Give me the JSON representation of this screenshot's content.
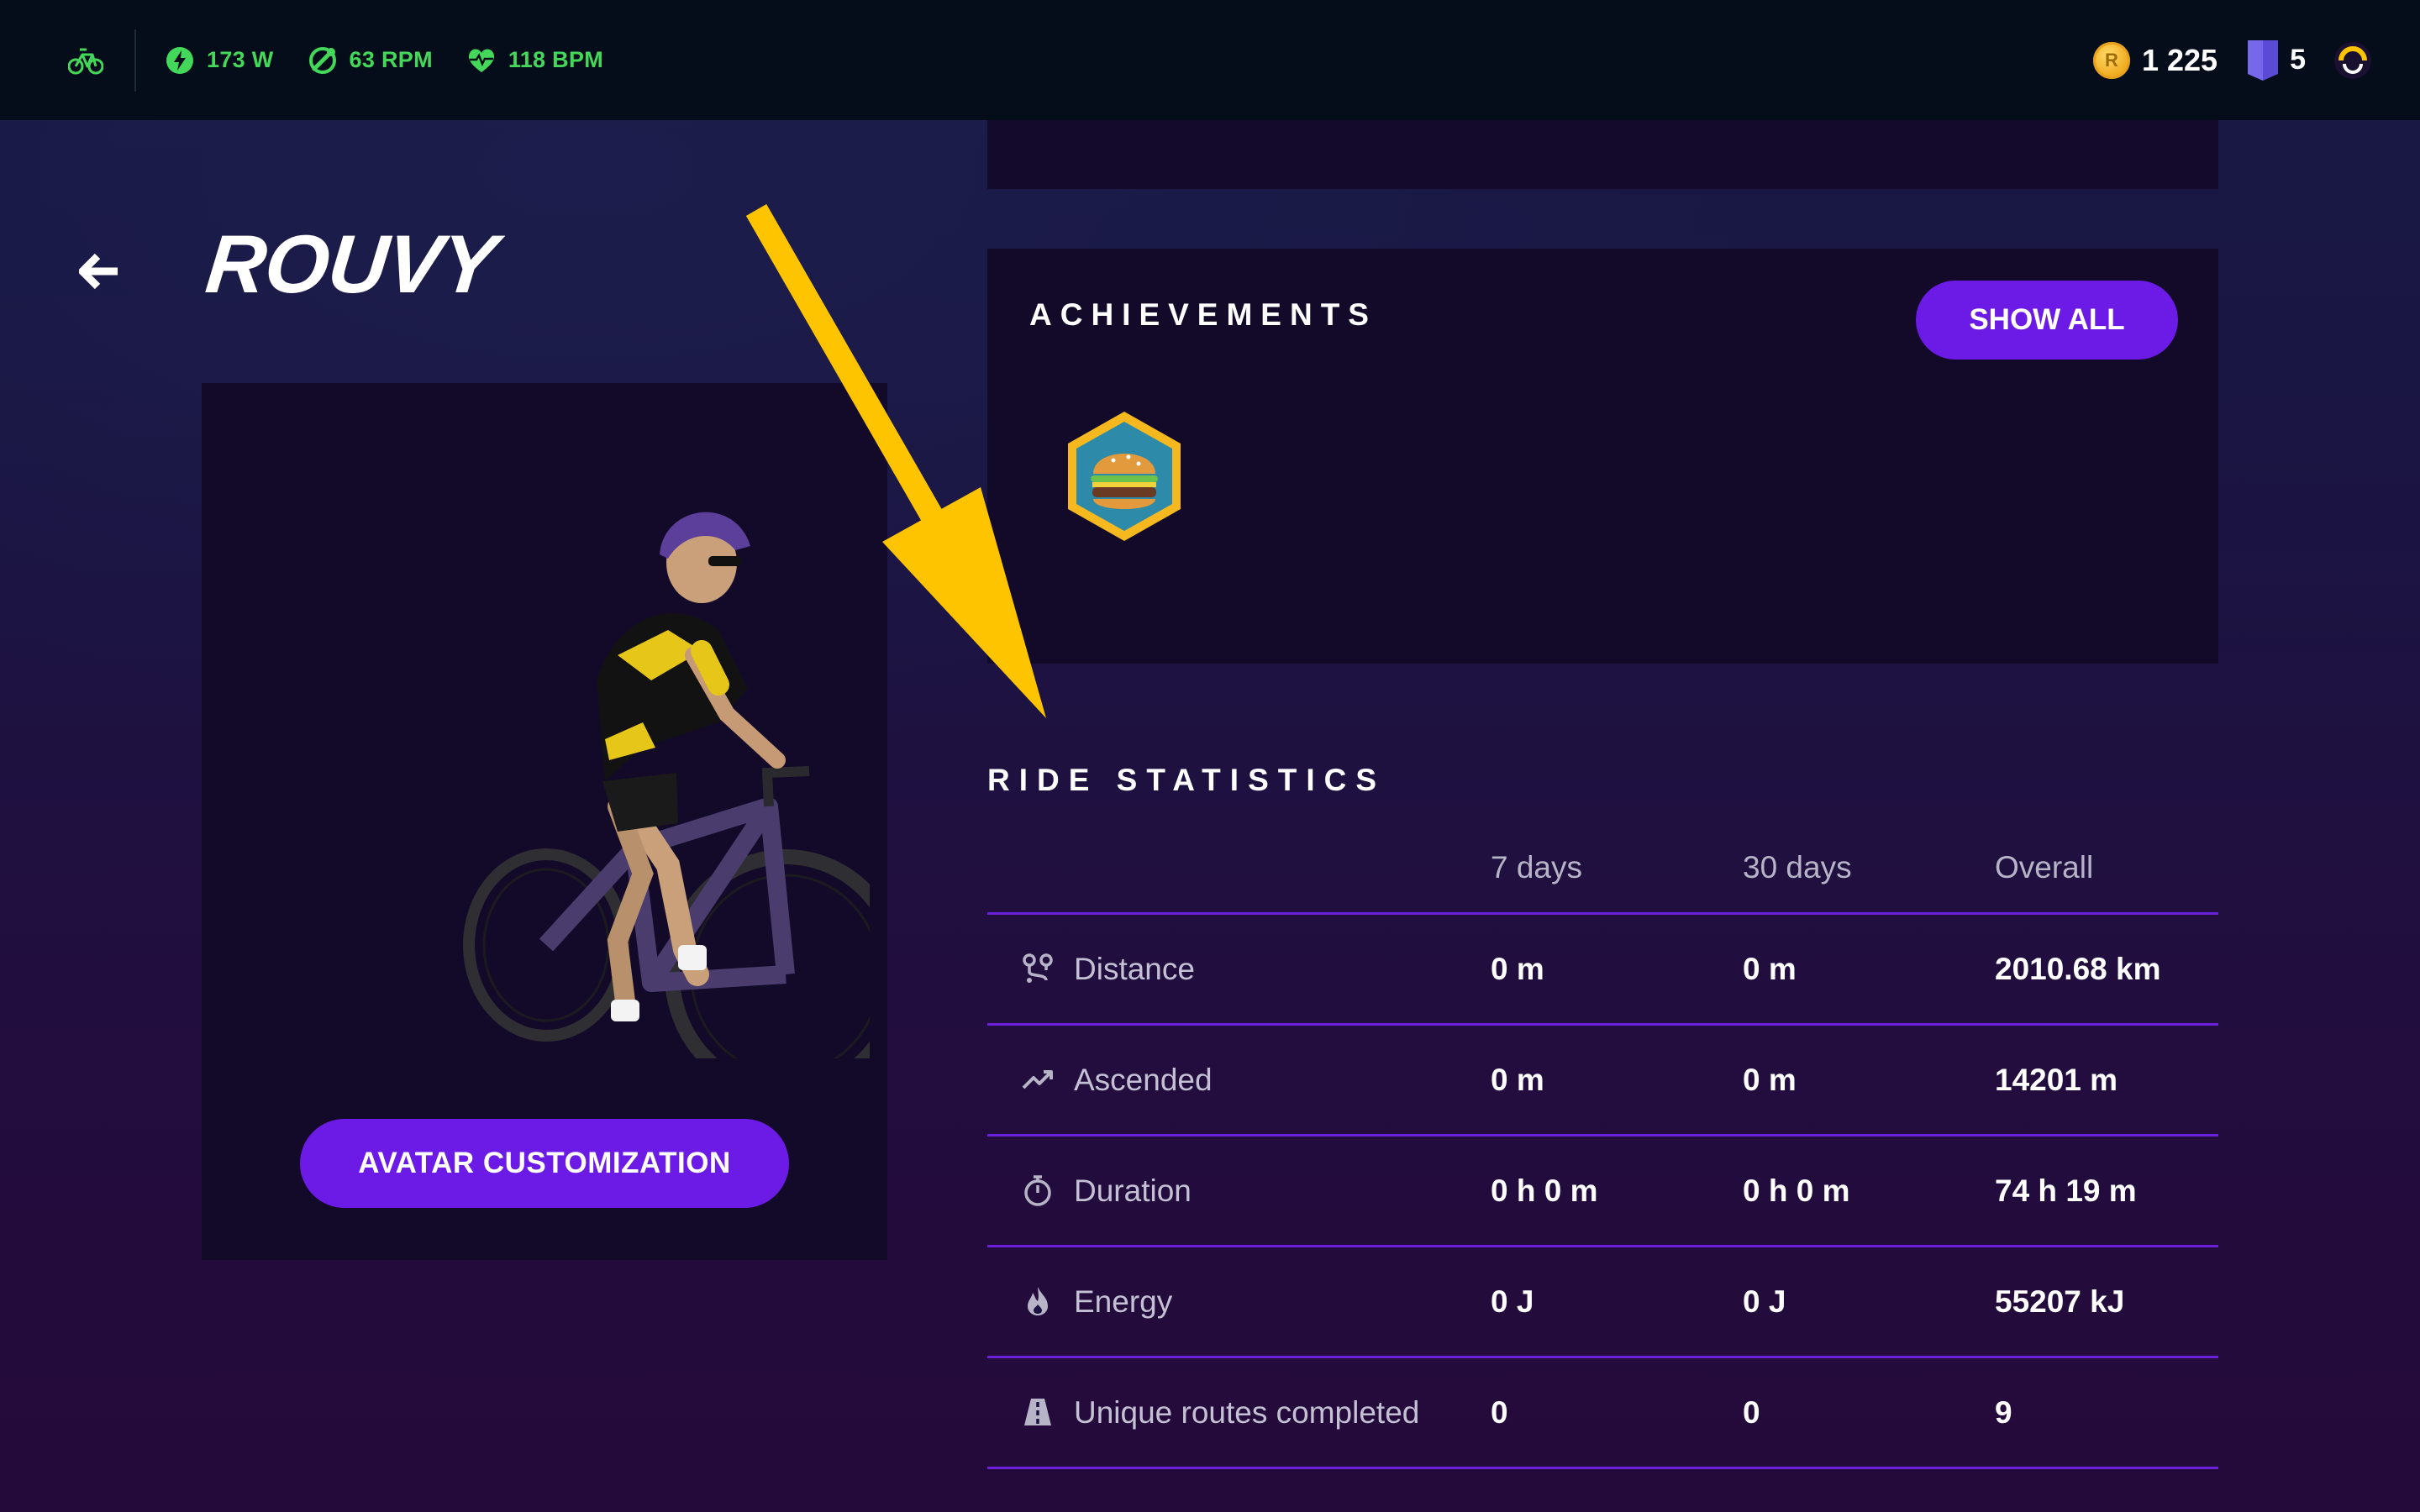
{
  "topbar": {
    "icons": {
      "bike": "bicycle-icon",
      "power": "lightning-icon",
      "cadence": "cadence-icon",
      "heart": "heart-rate-icon",
      "coin": "coin-icon",
      "level": "shield-icon",
      "logo": "rouvy-logo-icon"
    },
    "power": "173 W",
    "cadence": "63 RPM",
    "heart_rate": "118 BPM",
    "coins": "1 225",
    "coin_letter": "R",
    "level": "5",
    "metric_color": "#44d85a"
  },
  "profile": {
    "username": "ROUVY",
    "avatar_button": "AVATAR CUSTOMIZATION"
  },
  "achievements": {
    "title": "ACHIEVEMENTS",
    "show_all": "SHOW ALL",
    "badges": [
      "burger-badge-icon"
    ]
  },
  "ride_statistics": {
    "title": "RIDE STATISTICS",
    "columns": [
      "7 days",
      "30 days",
      "Overall"
    ],
    "rows": [
      {
        "icon": "distance-icon",
        "label": "Distance",
        "d7": "0 m",
        "d30": "0 m",
        "overall": "2010.68 km"
      },
      {
        "icon": "ascend-icon",
        "label": "Ascended",
        "d7": "0 m",
        "d30": "0 m",
        "overall": "14201 m"
      },
      {
        "icon": "stopwatch-icon",
        "label": "Duration",
        "d7": "0 h 0 m",
        "d30": "0 h 0 m",
        "overall": "74 h 19 m"
      },
      {
        "icon": "flame-icon",
        "label": "Energy",
        "d7": "0 J",
        "d30": "0 J",
        "overall": "55207 kJ"
      },
      {
        "icon": "road-icon",
        "label": "Unique routes completed",
        "d7": "0",
        "d30": "0",
        "overall": "9"
      }
    ]
  },
  "colors": {
    "accent": "#6c1ae6",
    "divider": "#6a1fd8",
    "arrow": "#ffc400",
    "card": "#130a2a"
  }
}
